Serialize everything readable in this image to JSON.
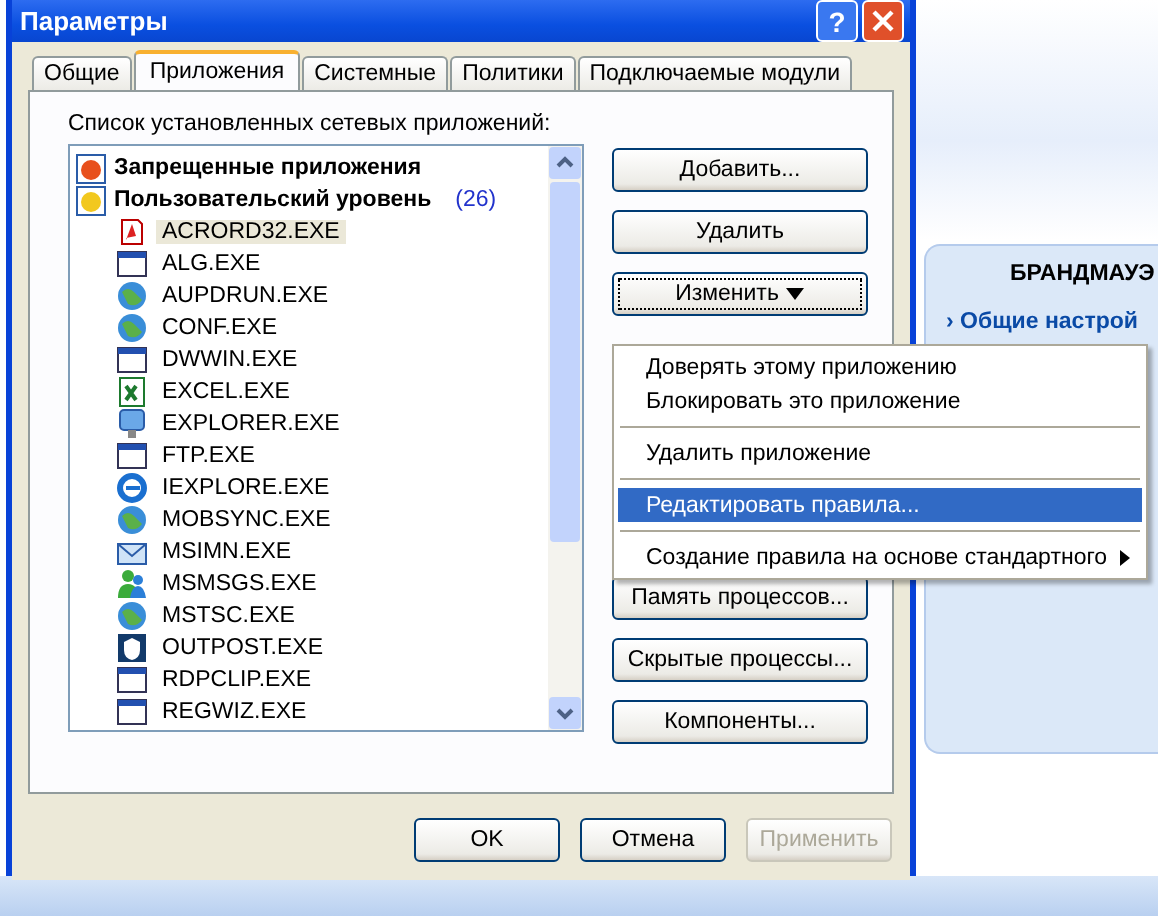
{
  "window": {
    "title": "Параметры",
    "help_button": "?"
  },
  "tabs": [
    {
      "label": "Общие",
      "selected": false
    },
    {
      "label": "Приложения",
      "selected": true
    },
    {
      "label": "Системные",
      "selected": false
    },
    {
      "label": "Политики",
      "selected": false
    },
    {
      "label": "Подключаемые модули",
      "selected": false
    }
  ],
  "list_label": "Список установленных сетевых приложений:",
  "app_list": {
    "groups": [
      {
        "label": "Запрещенные приложения",
        "color": "#e8501c"
      },
      {
        "label": "Пользовательский уровень",
        "color": "#f2c81e",
        "count": "(26)"
      }
    ],
    "items": [
      {
        "label": "ACRORD32.EXE",
        "selected": true
      },
      {
        "label": "ALG.EXE",
        "selected": false
      },
      {
        "label": "AUPDRUN.EXE",
        "selected": false
      },
      {
        "label": "CONF.EXE",
        "selected": false
      },
      {
        "label": "DWWIN.EXE",
        "selected": false
      },
      {
        "label": "EXCEL.EXE",
        "selected": false
      },
      {
        "label": "EXPLORER.EXE",
        "selected": false
      },
      {
        "label": "FTP.EXE",
        "selected": false
      },
      {
        "label": "IEXPLORE.EXE",
        "selected": false
      },
      {
        "label": "MOBSYNC.EXE",
        "selected": false
      },
      {
        "label": "MSIMN.EXE",
        "selected": false
      },
      {
        "label": "MSMSGS.EXE",
        "selected": false
      },
      {
        "label": "MSTSC.EXE",
        "selected": false
      },
      {
        "label": "OUTPOST.EXE",
        "selected": false
      },
      {
        "label": "RDPCLIP.EXE",
        "selected": false
      },
      {
        "label": "REGWIZ.EXE",
        "selected": false
      }
    ]
  },
  "side_buttons_top": [
    {
      "label": "Добавить...",
      "dropdown": false,
      "focused": false
    },
    {
      "label": "Удалить",
      "dropdown": false,
      "focused": false
    },
    {
      "label": "Изменить",
      "dropdown": true,
      "focused": true
    }
  ],
  "side_buttons_bottom": [
    {
      "label": "Память процессов..."
    },
    {
      "label": "Скрытые процессы..."
    },
    {
      "label": "Компоненты..."
    }
  ],
  "context_menu": [
    {
      "kind": "item",
      "label": "Доверять этому приложению",
      "selected": false,
      "submenu": false
    },
    {
      "kind": "item",
      "label": "Блокировать это приложение",
      "selected": false,
      "submenu": false
    },
    {
      "kind": "separator"
    },
    {
      "kind": "item",
      "label": "Удалить приложение",
      "selected": false,
      "submenu": false
    },
    {
      "kind": "separator"
    },
    {
      "kind": "item",
      "label": "Редактировать правила...",
      "selected": true,
      "submenu": false
    },
    {
      "kind": "separator"
    },
    {
      "kind": "item",
      "label": "Создание правила на основе стандартного",
      "selected": false,
      "submenu": true
    }
  ],
  "dialog_buttons": [
    {
      "label": "OK",
      "disabled": false
    },
    {
      "label": "Отмена",
      "disabled": false
    },
    {
      "label": "Применить",
      "disabled": true
    }
  ],
  "background_window": {
    "heading": "БРАНДМАУЭ",
    "link_marker": "›",
    "link": "Общие настрой"
  }
}
